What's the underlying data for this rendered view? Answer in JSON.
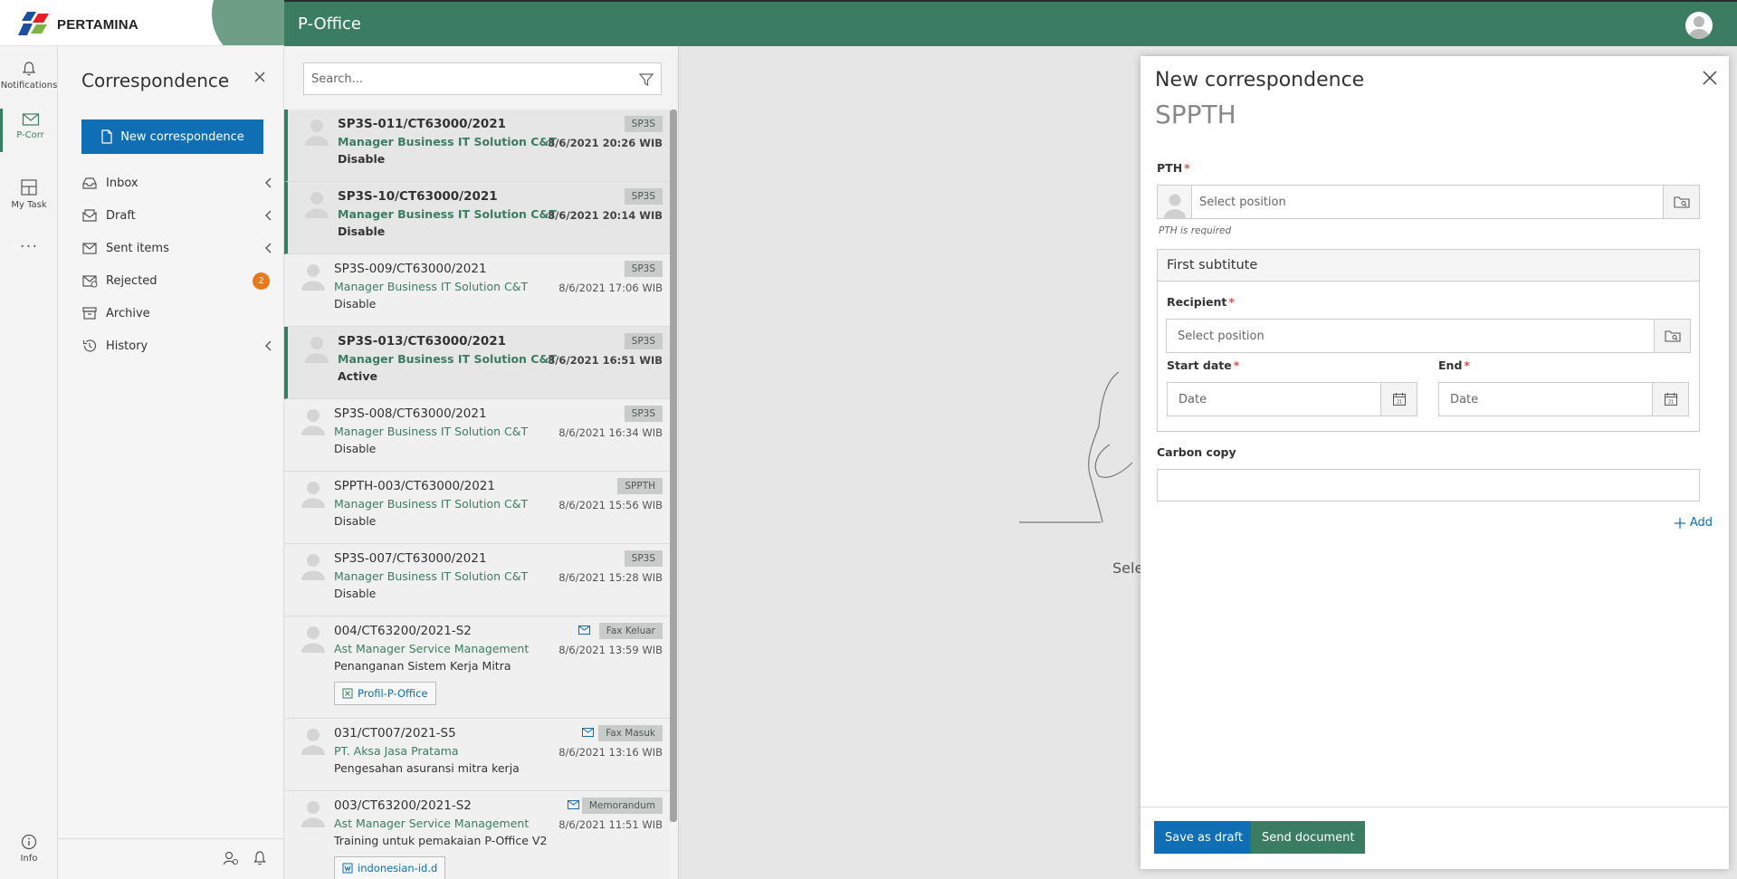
{
  "brand": {
    "name": "PERTAMINA"
  },
  "header": {
    "app_title": "P-Office"
  },
  "rail": {
    "items": [
      {
        "label": "Notifications",
        "icon": "bell-icon"
      },
      {
        "label": "P-Corr",
        "icon": "mail-icon"
      },
      {
        "label": "My Task",
        "icon": "grid-icon"
      }
    ],
    "more": "...",
    "info_label": "Info"
  },
  "nav": {
    "heading": "Correspondence",
    "new_button": "New correspondence",
    "items": [
      {
        "label": "Inbox",
        "icon": "inbox-icon",
        "expandable": true
      },
      {
        "label": "Draft",
        "icon": "draft-icon",
        "expandable": true
      },
      {
        "label": "Sent items",
        "icon": "sent-icon",
        "expandable": true
      },
      {
        "label": "Rejected",
        "icon": "rejected-icon",
        "badge": "2"
      },
      {
        "label": "Archive",
        "icon": "archive-icon"
      },
      {
        "label": "History",
        "icon": "history-icon",
        "expandable": true
      }
    ]
  },
  "list": {
    "search_placeholder": "Search...",
    "rows": [
      {
        "code": "SP3S-011/CT63000/2021",
        "from": "Manager Business IT Solution C&T",
        "subject": "Disable",
        "tag": "SP3S",
        "date": "8/6/2021 20:26 WIB",
        "unread": true
      },
      {
        "code": "SP3S-10/CT63000/2021",
        "from": "Manager Business IT Solution C&T",
        "subject": "Disable",
        "tag": "SP3S",
        "date": "8/6/2021 20:14 WIB",
        "unread": true
      },
      {
        "code": "SP3S-009/CT63000/2021",
        "from": "Manager Business IT Solution C&T",
        "subject": "Disable",
        "tag": "SP3S",
        "date": "8/6/2021 17:06 WIB",
        "unread": false
      },
      {
        "code": "SP3S-013/CT63000/2021",
        "from": "Manager Business IT Solution C&T",
        "subject": "Active",
        "tag": "SP3S",
        "date": "8/6/2021 16:51 WIB",
        "unread": true
      },
      {
        "code": "SP3S-008/CT63000/2021",
        "from": "Manager Business IT Solution C&T",
        "subject": "Disable",
        "tag": "SP3S",
        "date": "8/6/2021 16:34 WIB",
        "unread": false
      },
      {
        "code": "SPPTH-003/CT63000/2021",
        "from": "Manager Business IT Solution C&T",
        "subject": "Disable",
        "tag": "SPPTH",
        "date": "8/6/2021 15:56 WIB",
        "unread": false
      },
      {
        "code": "SP3S-007/CT63000/2021",
        "from": "Manager Business IT Solution C&T",
        "subject": "Disable",
        "tag": "SP3S",
        "date": "8/6/2021 15:28 WIB",
        "unread": false
      },
      {
        "code": "004/CT63200/2021-S2",
        "from": "Ast Manager Service Management",
        "subject": "Penanganan Sistem Kerja Mitra",
        "tag": "Fax Keluar",
        "date": "8/6/2021 13:59 WIB",
        "unread": false,
        "attachment": "Profil-P-Office"
      },
      {
        "code": "031/CT007/2021-S5",
        "from": "PT. Aksa Jasa Pratama",
        "subject": "Pengesahan asuransi mitra kerja",
        "tag": "Fax Masuk",
        "date": "8/6/2021 13:16 WIB",
        "unread": false
      },
      {
        "code": "003/CT63200/2021-S2",
        "from": "Ast Manager Service Management",
        "subject": "Training untuk pemakaian P-Office V2",
        "tag": "Memorandum",
        "date": "8/6/2021 11:51 WIB",
        "unread": false,
        "attachment": "indonesian-id.d"
      }
    ]
  },
  "background": {
    "partial_text": "Sele"
  },
  "dialog": {
    "title": "New correspondence",
    "subtitle": "SPPTH",
    "pth_label": "PTH",
    "pth_placeholder": "Select position",
    "pth_hint": "PTH is required",
    "substitute_heading": "First subtitute",
    "recipient_label": "Recipient",
    "recipient_placeholder": "Select position",
    "start_label": "Start date",
    "start_placeholder": "Date",
    "end_label": "End",
    "end_placeholder": "Date",
    "cc_label": "Carbon copy",
    "add_label": "Add",
    "save_draft": "Save as draft",
    "send": "Send document"
  },
  "colors": {
    "brand_green": "#3b7d62",
    "primary_blue": "#0f6eb4",
    "badge_orange": "#e87a1d"
  }
}
